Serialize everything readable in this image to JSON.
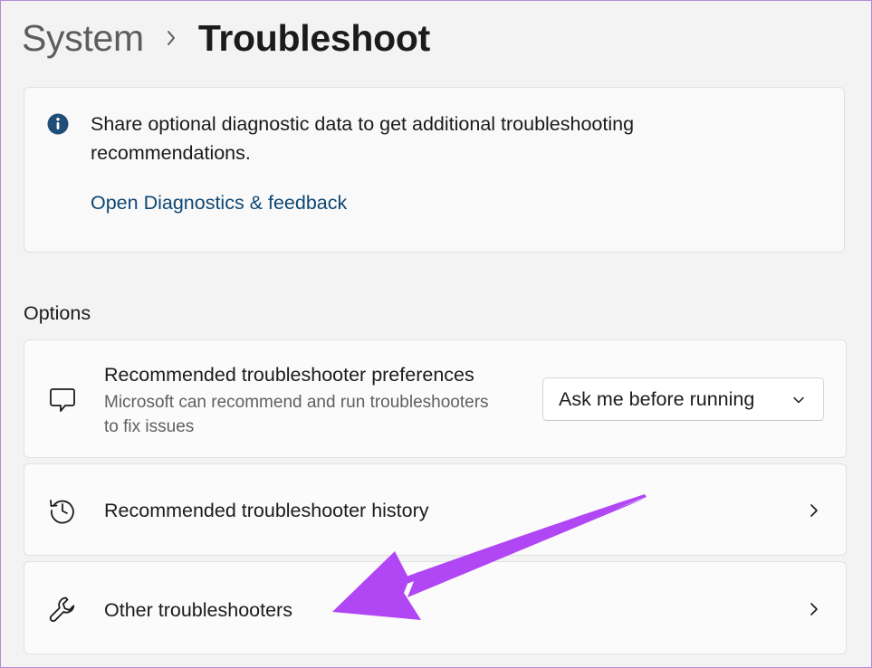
{
  "breadcrumb": {
    "parent": "System",
    "current": "Troubleshoot",
    "separator_icon": "chevron-right-icon"
  },
  "info_card": {
    "icon": "info-icon",
    "text": "Share optional diagnostic data to get additional troubleshooting recommendations.",
    "link": "Open Diagnostics & feedback"
  },
  "options": {
    "heading": "Options",
    "items": [
      {
        "icon": "chat-bubble-icon",
        "title": "Recommended troubleshooter preferences",
        "description": "Microsoft can recommend and run troubleshooters to fix issues",
        "dropdown_value": "Ask me before running"
      },
      {
        "icon": "history-icon",
        "title": "Recommended troubleshooter history"
      },
      {
        "icon": "wrench-icon",
        "title": "Other troubleshooters"
      }
    ]
  },
  "colors": {
    "background": "#f3f3f3",
    "card": "#fbfbfb",
    "link": "#0e4774",
    "info_icon": "#1f4e79",
    "annotation_arrow": "#b146f5"
  }
}
